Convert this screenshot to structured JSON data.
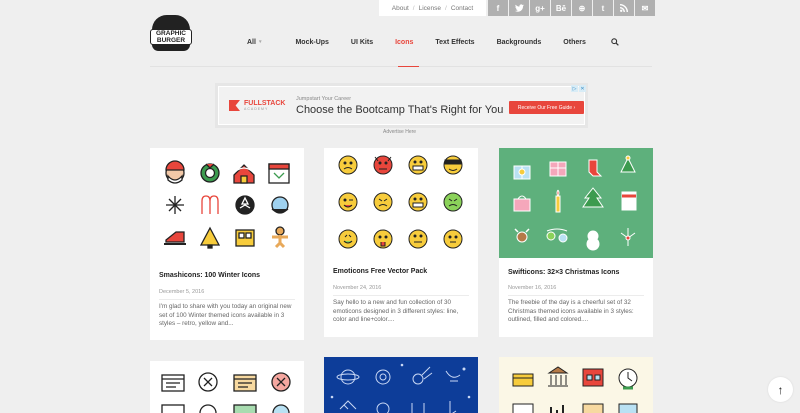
{
  "toplinks": [
    "About",
    "License",
    "Contact"
  ],
  "social_icons": [
    "facebook-icon",
    "twitter-icon",
    "google-plus-icon",
    "behance-icon",
    "dribbble-icon",
    "tumblr-icon",
    "rss-icon",
    "mail-icon"
  ],
  "social_glyphs": [
    "f",
    "t",
    "g+",
    "Bē",
    "⊕",
    "t",
    "⊃",
    "✉"
  ],
  "logo": {
    "line1": "GRAPHIC",
    "line2": "BURGER"
  },
  "nav": {
    "items": [
      "All",
      "Mock-Ups",
      "UI Kits",
      "Icons",
      "Text Effects",
      "Backgrounds",
      "Others"
    ],
    "active": "Icons",
    "caret": "▾",
    "accent": "#e8463c"
  },
  "ad": {
    "brand": "FULLSTACK",
    "brand_sub": "ACADEMY",
    "pretitle": "Jumpstart Your Career",
    "headline": "Choose the Bootcamp That's Right for You",
    "cta": "Receive Our Free Guide ›",
    "adchoices": [
      "▷",
      "✕"
    ],
    "label": "Advertise Here"
  },
  "cards": [
    {
      "title": "Smashicons: 100 Winter Icons",
      "date": "December 5, 2016",
      "excerpt": "I'm glad to share with you today an original new set of 100 Winter themed icons available in 3 styles – retro, yellow and..."
    },
    {
      "title": "Emoticons Free Vector Pack",
      "date": "November 24, 2016",
      "excerpt": "Say hello to a new and fun collection of 30 emoticons designed in 3 different styles: line, color and line+color...."
    },
    {
      "title": "Swifticons: 32×3 Christmas Icons",
      "date": "November 16, 2016",
      "excerpt": "The freebie of the day is a cheerful set of 32 Christmas themed icons available in 3 styles: outlined, filled and colored...."
    }
  ],
  "card_colors": {
    "emoji_yellow": "#f7cc3c",
    "christmas_green": "#5eb07c",
    "blue_pattern": "#0d3d99",
    "cream": "#fbf7e6"
  },
  "back_to_top": "↑"
}
